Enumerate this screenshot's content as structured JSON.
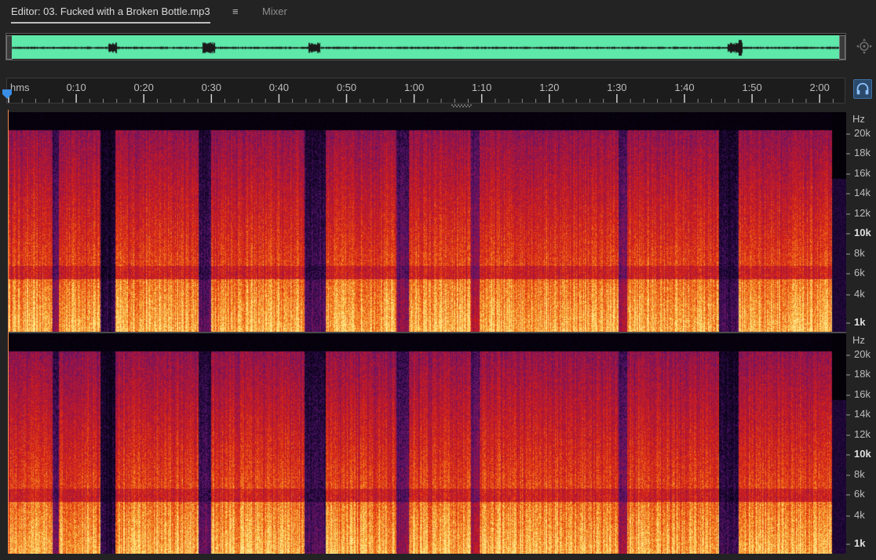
{
  "tabs": {
    "editor_label": "Editor: 03. Fucked with a Broken Bottle.mp3",
    "menu_glyph": "≡",
    "mixer_label": "Mixer"
  },
  "ruler": {
    "unit": "hms",
    "labels": [
      "0:10",
      "0:20",
      "0:30",
      "0:40",
      "0:50",
      "1:00",
      "1:10",
      "1:20",
      "1:30",
      "1:40",
      "1:50",
      "2:00"
    ]
  },
  "frequency_axis": {
    "unit": "Hz",
    "labels": [
      "20k",
      "18k",
      "16k",
      "14k",
      "12k",
      "10k",
      "8k",
      "6k",
      "4k",
      "1k"
    ]
  },
  "icons": {
    "zoom_navigator": "zoom-navigator-icon",
    "playhead": "playhead-icon",
    "monitor": "headphones-icon"
  },
  "colors": {
    "overview_waveform": "#5ee8a9",
    "cursor": "#f08a4b",
    "monitor_button": "#2b4a6b"
  }
}
